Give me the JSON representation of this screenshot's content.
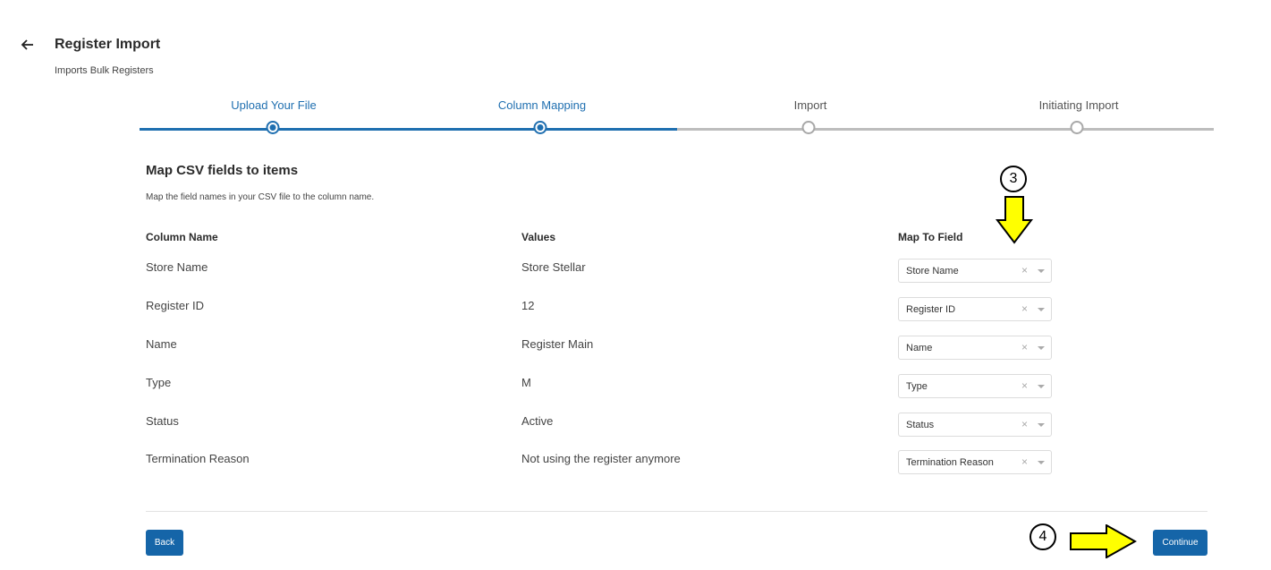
{
  "header": {
    "title": "Register Import",
    "subtitle": "Imports Bulk Registers",
    "back_icon": "arrow-left-icon"
  },
  "stepper": {
    "steps": [
      {
        "label": "Upload Your File",
        "state": "completed"
      },
      {
        "label": "Column Mapping",
        "state": "current"
      },
      {
        "label": "Import",
        "state": "pending"
      },
      {
        "label": "Initiating Import",
        "state": "pending"
      }
    ]
  },
  "mapping": {
    "title": "Map CSV fields to items",
    "description": "Map the field names in your CSV file to the column name.",
    "headers": {
      "column_name": "Column Name",
      "values": "Values",
      "map_to_field": "Map To Field"
    },
    "rows": [
      {
        "column": "Store Name",
        "value": "Store Stellar",
        "field": "Store Name"
      },
      {
        "column": "Register ID",
        "value": "12",
        "field": "Register ID"
      },
      {
        "column": "Name",
        "value": "Register Main",
        "field": "Name"
      },
      {
        "column": "Type",
        "value": "M",
        "field": "Type"
      },
      {
        "column": "Status",
        "value": "Active",
        "field": "Status"
      },
      {
        "column": "Termination Reason",
        "value": "Not using the register anymore",
        "field": "Termination Reason"
      }
    ],
    "clear_glyph": "×"
  },
  "footer": {
    "back_label": "Back",
    "continue_label": "Continue"
  },
  "annotations": {
    "callout_3": "3",
    "callout_4": "4"
  },
  "colors": {
    "accent": "#1f6fb0",
    "button": "#1565a8",
    "arrow_fill": "#ffff00"
  }
}
